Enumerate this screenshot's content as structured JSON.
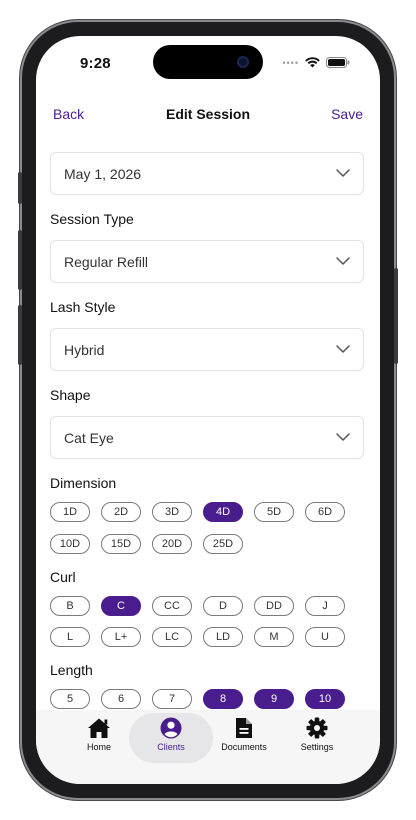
{
  "status": {
    "time": "9:28"
  },
  "nav": {
    "back": "Back",
    "title": "Edit Session",
    "save": "Save"
  },
  "date": {
    "value": "May 1, 2026"
  },
  "session_type": {
    "label": "Session Type",
    "value": "Regular Refill"
  },
  "lash_style": {
    "label": "Lash Style",
    "value": "Hybrid"
  },
  "shape": {
    "label": "Shape",
    "value": "Cat Eye"
  },
  "dimension": {
    "label": "Dimension",
    "row1": [
      "1D",
      "2D",
      "3D",
      "4D",
      "5D",
      "6D"
    ],
    "row2": [
      "10D",
      "15D",
      "20D",
      "25D"
    ],
    "selected": "4D"
  },
  "curl": {
    "label": "Curl",
    "row1": [
      "B",
      "C",
      "CC",
      "D",
      "DD",
      "J"
    ],
    "row2": [
      "L",
      "L+",
      "LC",
      "LD",
      "M",
      "U"
    ],
    "selected": "C"
  },
  "length": {
    "label": "Length",
    "row1": [
      "5",
      "6",
      "7",
      "8",
      "9",
      "10"
    ],
    "selected": [
      "8",
      "9",
      "10"
    ]
  },
  "tabs": [
    {
      "label": "Home",
      "icon": "home-icon"
    },
    {
      "label": "Clients",
      "icon": "person-circle-icon",
      "active": true
    },
    {
      "label": "Documents",
      "icon": "document-icon"
    },
    {
      "label": "Settings",
      "icon": "gear-icon"
    }
  ],
  "colors": {
    "accent": "#4a1d8f",
    "border": "#e2e2e2"
  }
}
